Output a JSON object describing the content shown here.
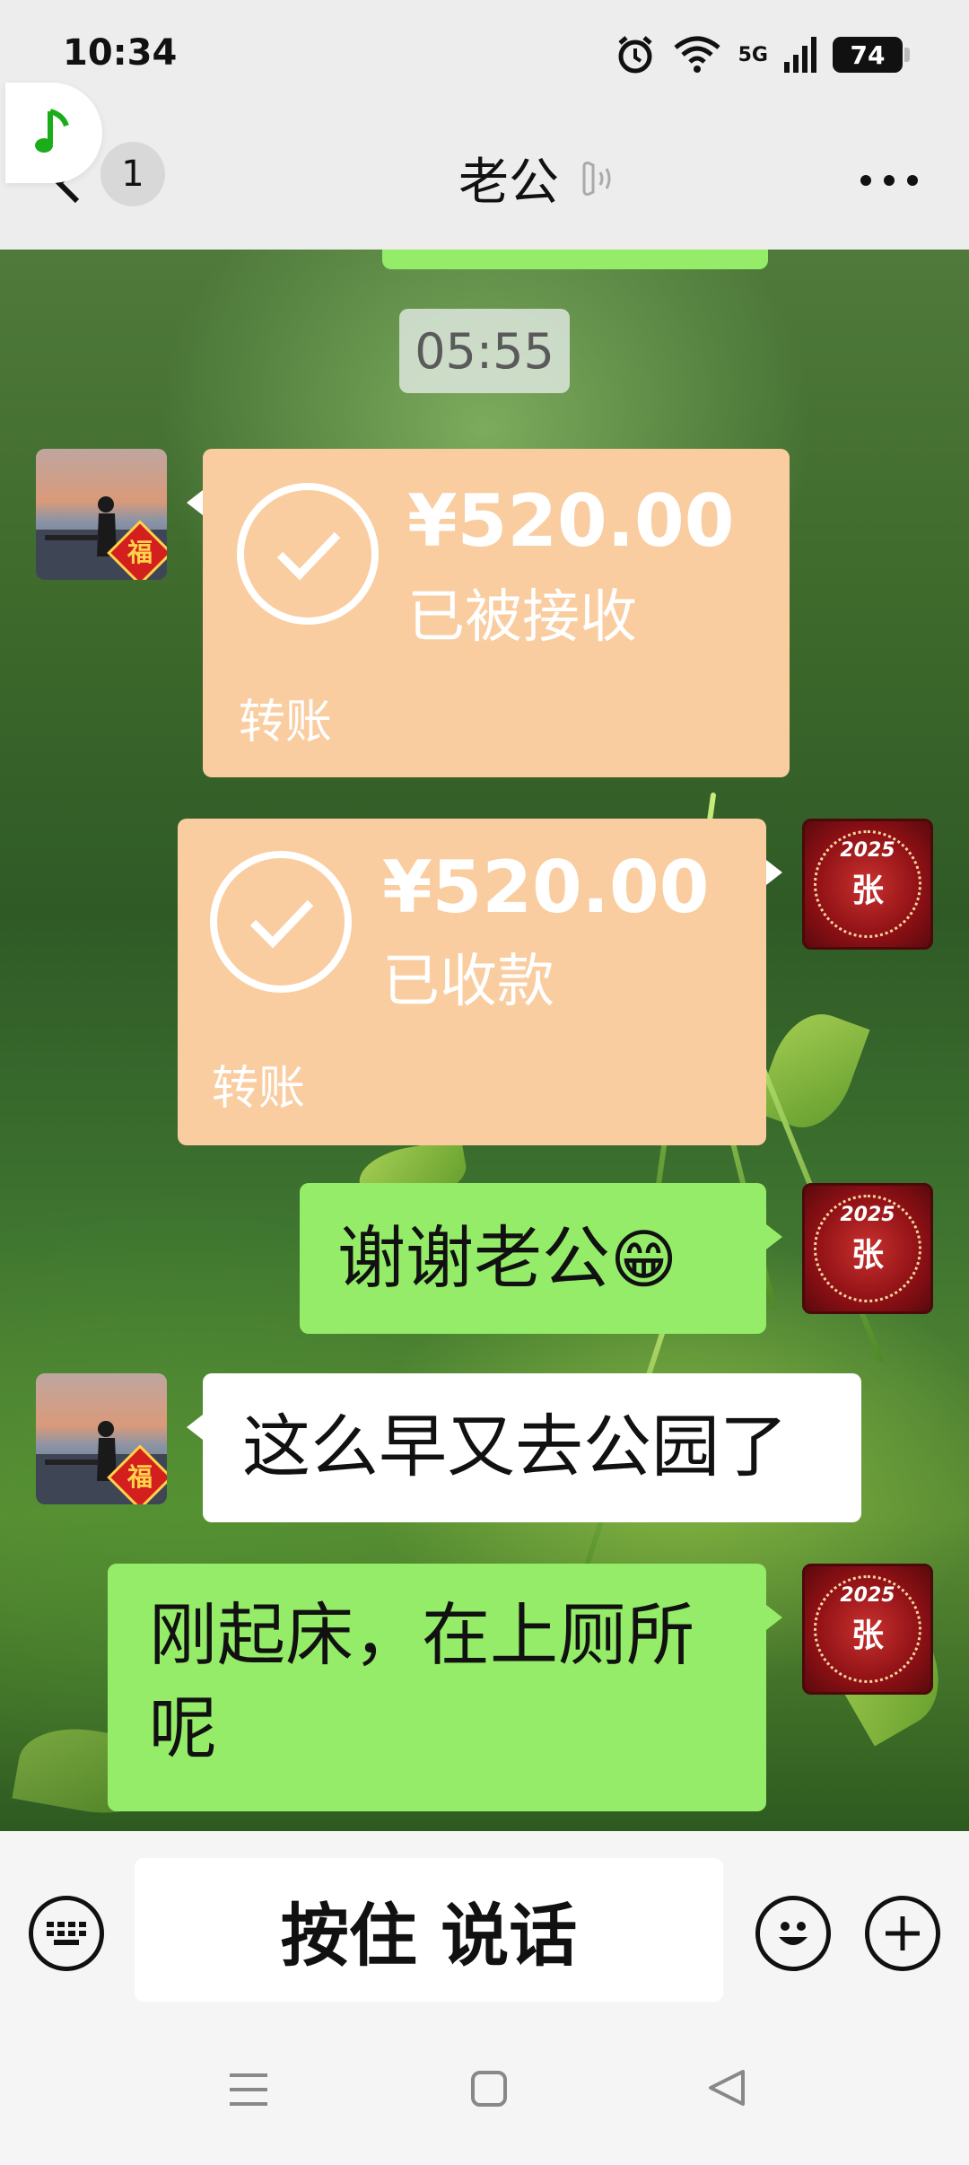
{
  "status_bar": {
    "time": "10:34",
    "network": "5G",
    "battery": "74"
  },
  "header": {
    "unread_count": "1",
    "title": "老公"
  },
  "messages": {
    "timestamp": "05:55",
    "transfer_received": {
      "amount": "¥520.00",
      "status": "已被接收",
      "label": "转账"
    },
    "transfer_collected": {
      "amount": "¥520.00",
      "status": "已收款",
      "label": "转账"
    },
    "thanks": {
      "text": "谢谢老公",
      "emoji": "😁"
    },
    "husband_question": "这么早又去公园了",
    "my_reply_line1": "刚起床，在上厕所",
    "my_reply_line2": "呢"
  },
  "avatars": {
    "husband_badge": "福",
    "me_char": "张",
    "me_year": "2025"
  },
  "input_bar": {
    "hold_to_talk": "按住 说话"
  },
  "colors": {
    "green_bubble": "#95ec69",
    "transfer_bubble": "#f9cda0",
    "header_bg": "#ededed"
  }
}
